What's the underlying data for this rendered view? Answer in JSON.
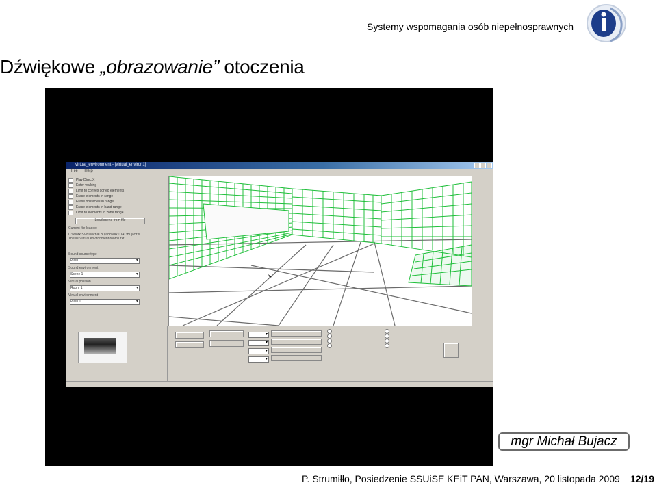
{
  "header": {
    "org_text": "Systemy wspomagania osób niepełnosprawnych",
    "logo_icon": "ie-logo-icon"
  },
  "slide": {
    "title_prefix": "Dźwiękowe ",
    "title_italic": "„obrazowanie”",
    "title_suffix": " otoczenia"
  },
  "video": {
    "app": {
      "window_title": "virtual_environment - [virtual_environ1]",
      "menu": [
        "File",
        "Help"
      ],
      "checkboxes": [
        "Play DirectX",
        "Enter walking",
        "Limit to convex sorted elements",
        "Erase elements in range",
        "Erase obstacles in range",
        "Erase elements in hand range",
        "Limit to elements in zone range"
      ],
      "load_button": "Load scene from file",
      "file_label": "Current file loaded:",
      "file_path": "C:\\Work\\SVN\\Michal Bujacz\\VIRTUAL\\Bujacz's Thesis\\Virtual environment\\room1.txt",
      "select_labels": [
        "Sound source type",
        "Sound environment",
        "Virtual position",
        "Virtual environment"
      ],
      "select_values": [
        "Plain",
        "Scene 1",
        "Room 1",
        "Plain 1"
      ]
    },
    "watermark": ""
  },
  "caption": {
    "author": "mgr Michał Bujacz"
  },
  "footer": {
    "text": "P. Strumiłło, Posiedzenie SSUiSE KEiT PAN, Warszawa, 20 listopada 2009",
    "page": "12/19"
  },
  "colors": {
    "grid_green": "#1fbf3a",
    "floor_lines": "#6a6a6a",
    "video_bg": "#000000",
    "win_bg": "#d4d0c8"
  }
}
